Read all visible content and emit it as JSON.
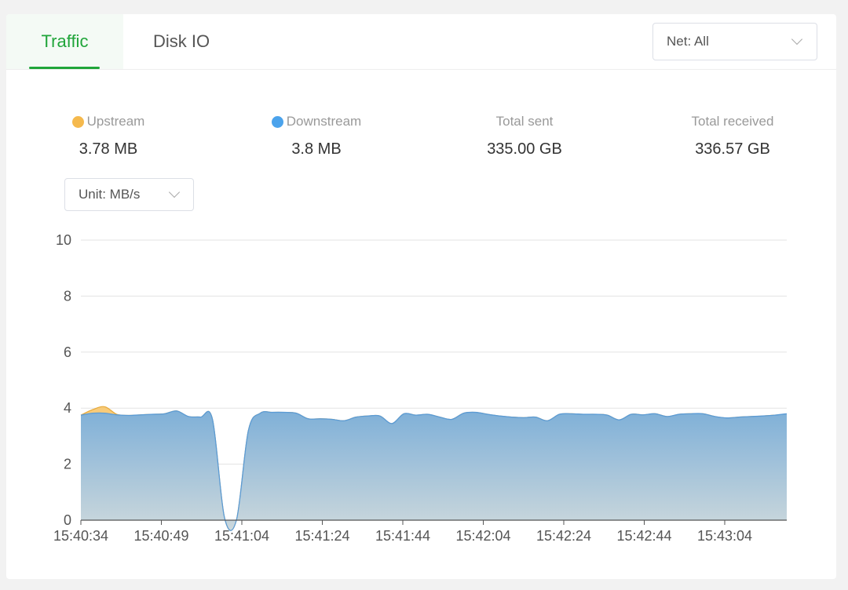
{
  "tabs": [
    {
      "label": "Traffic",
      "active": true
    },
    {
      "label": "Disk IO",
      "active": false
    }
  ],
  "net_select": {
    "value": "Net: All"
  },
  "stats": {
    "upstream": {
      "label": "Upstream",
      "value": "3.78 MB",
      "color": "#f5b94d"
    },
    "downstream": {
      "label": "Downstream",
      "value": "3.8 MB",
      "color": "#4ba3ec"
    },
    "total_sent": {
      "label": "Total sent",
      "value": "335.00 GB"
    },
    "total_received": {
      "label": "Total received",
      "value": "336.57 GB"
    }
  },
  "unit_select": {
    "value": "Unit: MB/s"
  },
  "colors": {
    "accent": "#20a53a",
    "upstream_fill": "#f7c56a",
    "downstream_line": "#5b9bd5",
    "grid": "#e3e3e3",
    "axis": "#555555"
  },
  "chart_data": {
    "type": "area",
    "xlabel": "",
    "ylabel": "",
    "ylim": [
      0,
      10
    ],
    "y_ticks": [
      0,
      2,
      4,
      6,
      8,
      10
    ],
    "x_tick_labels": [
      "15:40:34",
      "15:40:49",
      "15:41:04",
      "15:41:24",
      "15:41:44",
      "15:42:04",
      "15:42:24",
      "15:42:44",
      "15:43:04"
    ],
    "grid": true,
    "series": [
      {
        "name": "Upstream",
        "values": [
          3.75,
          3.95,
          4.05,
          3.78,
          3.74,
          3.76,
          3.78,
          3.8,
          3.9,
          3.7,
          3.68,
          3.6,
          0.1,
          0.0,
          3.2,
          3.82,
          3.85,
          3.85,
          3.82,
          3.62,
          3.62,
          3.6,
          3.55,
          3.68,
          3.72,
          3.72,
          3.45,
          3.8,
          3.75,
          3.78,
          3.68,
          3.6,
          3.82,
          3.85,
          3.78,
          3.72,
          3.68,
          3.66,
          3.68,
          3.55,
          3.78,
          3.8,
          3.78,
          3.78,
          3.75,
          3.58,
          3.78,
          3.76,
          3.8,
          3.7,
          3.78,
          3.8,
          3.8,
          3.7,
          3.65,
          3.68,
          3.7,
          3.72,
          3.75,
          3.78
        ]
      },
      {
        "name": "Downstream",
        "values": [
          3.75,
          3.82,
          3.82,
          3.76,
          3.74,
          3.76,
          3.78,
          3.8,
          3.9,
          3.7,
          3.68,
          3.6,
          0.1,
          0.0,
          3.2,
          3.82,
          3.85,
          3.85,
          3.82,
          3.62,
          3.62,
          3.6,
          3.55,
          3.68,
          3.72,
          3.72,
          3.45,
          3.8,
          3.75,
          3.78,
          3.68,
          3.6,
          3.82,
          3.85,
          3.78,
          3.72,
          3.68,
          3.66,
          3.68,
          3.55,
          3.78,
          3.8,
          3.78,
          3.78,
          3.75,
          3.58,
          3.78,
          3.76,
          3.8,
          3.7,
          3.78,
          3.8,
          3.8,
          3.7,
          3.65,
          3.68,
          3.7,
          3.72,
          3.75,
          3.8
        ]
      }
    ]
  }
}
